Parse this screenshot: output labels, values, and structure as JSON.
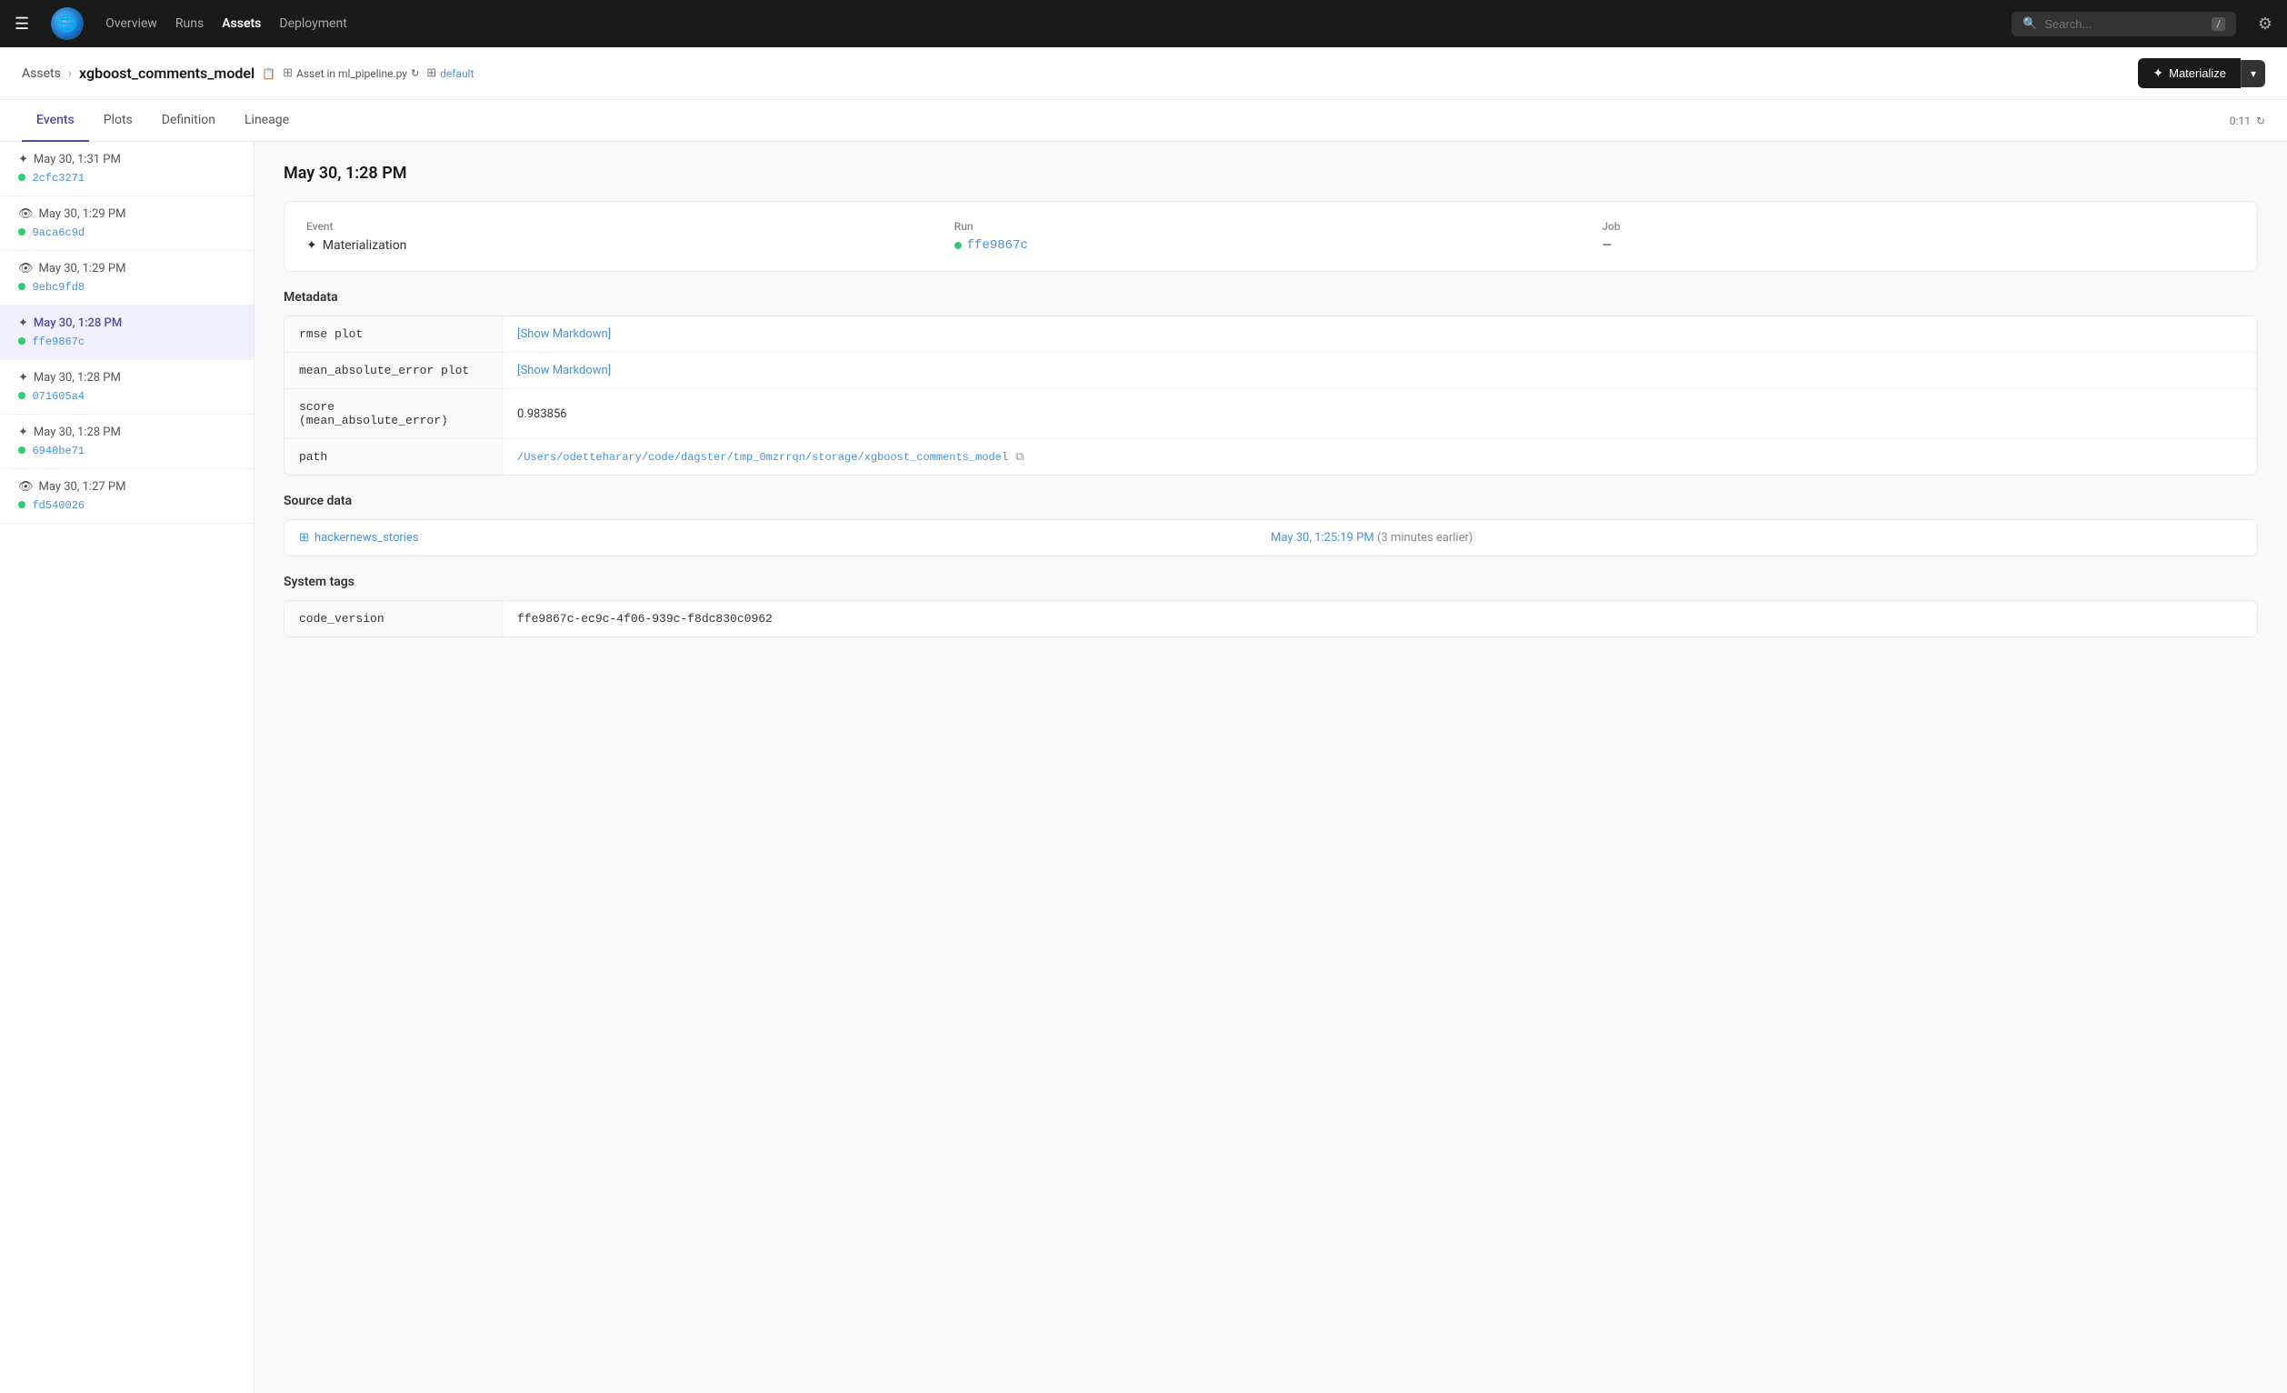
{
  "topnav": {
    "logo_emoji": "🌐",
    "links": [
      {
        "label": "Overview",
        "active": false
      },
      {
        "label": "Runs",
        "active": false
      },
      {
        "label": "Assets",
        "active": true
      },
      {
        "label": "Deployment",
        "active": false
      }
    ],
    "search_placeholder": "Search...",
    "search_kbd": "/",
    "gear_label": "Settings"
  },
  "breadcrumb": {
    "parent": "Assets",
    "current": "xgboost_comments_model",
    "meta_asset": "Asset in ml_pipeline.py",
    "meta_default": "default",
    "materialize_label": "Materialize"
  },
  "tabs": [
    {
      "label": "Events",
      "active": true
    },
    {
      "label": "Plots",
      "active": false
    },
    {
      "label": "Definition",
      "active": false
    },
    {
      "label": "Lineage",
      "active": false
    }
  ],
  "tab_refresh": "0:11",
  "events": [
    {
      "icon": "✦",
      "time": "May 30, 1:31 PM",
      "id": "2cfc3271",
      "active": false,
      "is_eye": false
    },
    {
      "icon": "👁",
      "time": "May 30, 1:29 PM",
      "id": "9aca6c9d",
      "active": false,
      "is_eye": true
    },
    {
      "icon": "👁",
      "time": "May 30, 1:29 PM",
      "id": "9ebc9fd8",
      "active": false,
      "is_eye": true
    },
    {
      "icon": "✦",
      "time": "May 30, 1:28 PM",
      "id": "ffe9867c",
      "active": true,
      "is_eye": false
    },
    {
      "icon": "✦",
      "time": "May 30, 1:28 PM",
      "id": "071605a4",
      "active": false,
      "is_eye": false
    },
    {
      "icon": "✦",
      "time": "May 30, 1:28 PM",
      "id": "6940be71",
      "active": false,
      "is_eye": false
    },
    {
      "icon": "👁",
      "time": "May 30, 1:27 PM",
      "id": "fd540026",
      "active": false,
      "is_eye": true
    }
  ],
  "detail": {
    "title": "May 30, 1:28 PM",
    "event_label": "Event",
    "event_value": "Materialization",
    "event_icon": "✦",
    "run_label": "Run",
    "run_id": "ffe9867c",
    "job_label": "Job",
    "job_value": "—"
  },
  "metadata": {
    "title": "Metadata",
    "rows": [
      {
        "key": "rmse plot",
        "value": "[Show Markdown]",
        "is_link": true,
        "is_path": false
      },
      {
        "key": "mean_absolute_error plot",
        "value": "[Show Markdown]",
        "is_link": true,
        "is_path": false
      },
      {
        "key": "score\n(mean_absolute_error)",
        "value": "0.983856",
        "is_link": false,
        "is_path": false
      },
      {
        "key": "path",
        "value": "/Users/odetteharary/code/dagster/tmp_0mzrrqn/storage/xgboost_comments_model",
        "is_link": false,
        "is_path": true
      }
    ]
  },
  "source_data": {
    "title": "Source data",
    "source_name": "hackernews_stories",
    "source_time": "May 30, 1:25:19 PM",
    "source_time_ago": "(3 minutes earlier)"
  },
  "system_tags": {
    "title": "System tags",
    "rows": [
      {
        "key": "code_version",
        "value": "ffe9867c-ec9c-4f06-939c-f8dc830c0962"
      }
    ]
  }
}
